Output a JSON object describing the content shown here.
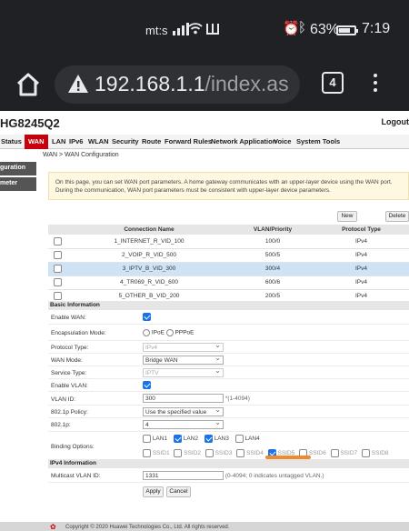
{
  "status_bar": {
    "carrier": "mt:s",
    "battery": "63%",
    "time": "7:19",
    "icons": [
      "signal-icon",
      "wifi-icon",
      "book-icon",
      "alarm-icon",
      "bluetooth-icon",
      "battery-icon"
    ]
  },
  "browser": {
    "url_host": "192.168.1.1",
    "url_path": "/index.as",
    "tab_count": "4",
    "icons": [
      "home-icon",
      "warning-icon",
      "menu-icon"
    ]
  },
  "router": {
    "model": "HG8245Q2",
    "logout": "Logout",
    "nav": [
      "Status",
      "WAN",
      "LAN",
      "IPv6",
      "WLAN",
      "Security",
      "Route",
      "Forward Rules",
      "Network Application",
      "Voice",
      "System Tools"
    ],
    "active_nav": "WAN",
    "left_nav": [
      "guration",
      "meter"
    ],
    "breadcrumb": "WAN > WAN Configuration",
    "notice": "On this page, you can set WAN port parameters. A home gateway communicates with an upper-layer device using the WAN port. During the communication, WAN port parameters must be consistent with upper-layer device parameters.",
    "buttons": {
      "new": "New",
      "delete": "Delete",
      "apply": "Apply",
      "cancel": "Cancel"
    },
    "table": {
      "headers": [
        "Connection Name",
        "VLAN/Priority",
        "Protocol Type"
      ],
      "rows": [
        {
          "name": "1_INTERNET_R_VID_100",
          "vlan": "100/0",
          "proto": "IPv4"
        },
        {
          "name": "2_VOIP_R_VID_500",
          "vlan": "500/5",
          "proto": "IPv4"
        },
        {
          "name": "3_IPTV_B_VID_300",
          "vlan": "300/4",
          "proto": "IPv4"
        },
        {
          "name": "4_TR069_R_VID_600",
          "vlan": "600/6",
          "proto": "IPv4"
        },
        {
          "name": "5_OTHER_B_VID_200",
          "vlan": "200/5",
          "proto": "IPv4"
        }
      ],
      "selected_row": 3
    },
    "basic": {
      "title": "Basic Information",
      "enable_wan_label": "Enable WAN:",
      "encap_label": "Encapsulation Mode:",
      "encap_options": [
        "IPoE",
        "PPPoE"
      ],
      "protocol_label": "Protocol Type:",
      "protocol_value": "IPv4",
      "wan_mode_label": "WAN Mode:",
      "wan_mode_value": "Bridge WAN",
      "service_label": "Service Type:",
      "service_value": "IPTV",
      "enable_vlan_label": "Enable VLAN:",
      "vlan_id_label": "VLAN ID:",
      "vlan_id_value": "300",
      "vlan_id_hint": "*(1-4094)",
      "policy_label": "802.1p Policy:",
      "policy_value": "Use the specified value",
      "p_label": "802.1p:",
      "p_value": "4",
      "binding_label": "Binding Options:",
      "binding_lan": [
        "LAN1",
        "LAN2",
        "LAN3",
        "LAN4"
      ],
      "binding_ssid": [
        "SSID1",
        "SSID2",
        "SSID3",
        "SSID4",
        "SSID5",
        "SSID6",
        "SSID7",
        "SSID8"
      ]
    },
    "ipv4": {
      "title": "IPv4 Information",
      "mcast_label": "Multicast VLAN ID:",
      "mcast_value": "1331",
      "mcast_hint": "(0-4094; 0 indicates untagged VLAN.)"
    },
    "footer": "Copyright © 2020 Huawei Technologies Co., Ltd. All rights reserved."
  },
  "colors": {
    "accent": "#c7000b",
    "checkbox": "#1a73e8",
    "selected_row": "#cfe3f7",
    "highlight_mark": "#f08a2e"
  }
}
